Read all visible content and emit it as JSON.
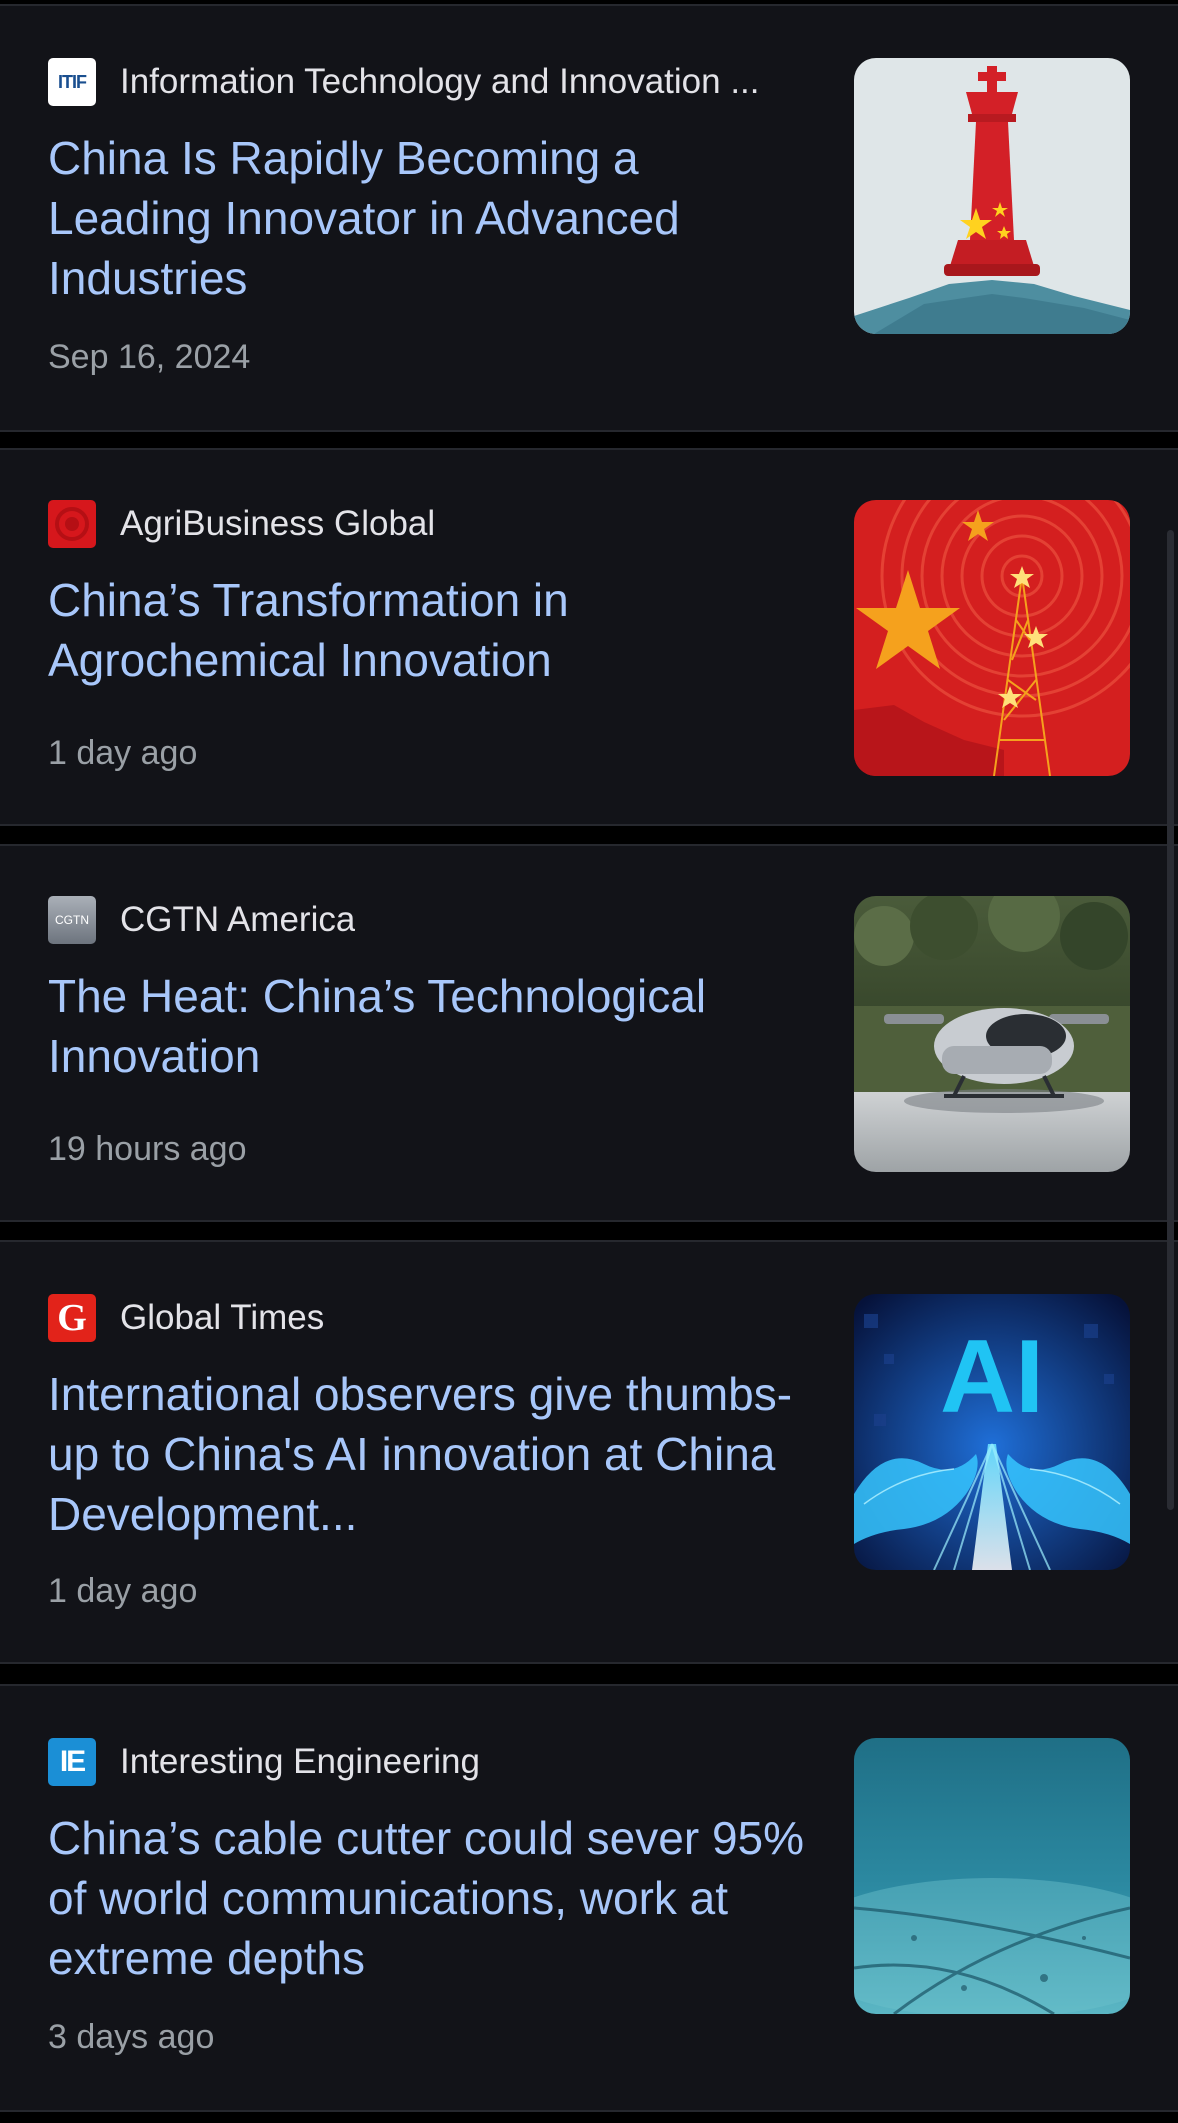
{
  "articles": [
    {
      "source": "Information Technology and Innovation ...",
      "favicon_text": "ITIF",
      "headline": "China Is Rapidly Becoming a Leading Innovator in Advanced Industries",
      "time": "Sep 16, 2024",
      "thumbnail": "chess-king-icon"
    },
    {
      "source": "AgriBusiness Global",
      "favicon_text": "",
      "headline": "China’s Transformation in Agrochemical Innovation",
      "time": "1 day ago",
      "thumbnail": "china-flag-tower-icon"
    },
    {
      "source": "CGTN America",
      "favicon_text": "CGTN",
      "headline": "The Heat: China’s Technological Innovation",
      "time": "19 hours ago",
      "thumbnail": "flying-car-photo"
    },
    {
      "source": "Global Times",
      "favicon_text": "G",
      "headline": "International observers give thumbs-up to China's AI innovation at China Development...",
      "time": "1 day ago",
      "thumbnail": "ai-hands-icon",
      "thumbnail_text": "AI"
    },
    {
      "source": "Interesting Engineering",
      "favicon_text": "IE",
      "headline": "China’s cable cutter could sever 95% of world communications, work at extreme depths",
      "time": "3 days ago",
      "thumbnail": "seabed-cables-photo"
    }
  ],
  "colors": {
    "background": "#000000",
    "card": "#121318",
    "headline": "#a8c7fa",
    "source": "#e3e3e8",
    "timestamp": "#9aa0a6"
  }
}
